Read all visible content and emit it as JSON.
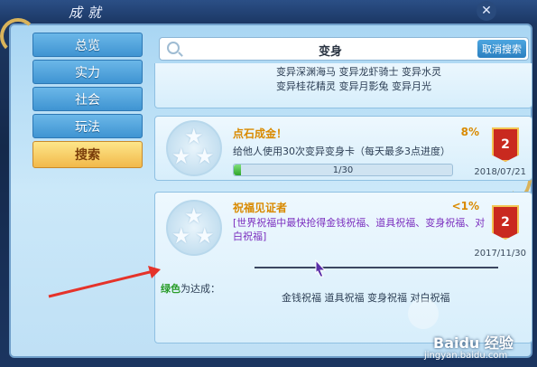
{
  "window": {
    "title": "成就",
    "close_icon": "close-icon"
  },
  "nav": {
    "items": [
      {
        "label": "总览",
        "active": false
      },
      {
        "label": "实力",
        "active": false
      },
      {
        "label": "社会",
        "active": false
      },
      {
        "label": "玩法",
        "active": false
      },
      {
        "label": "搜索",
        "active": true
      }
    ]
  },
  "search": {
    "value": "变身",
    "cancel_label": "取消搜索"
  },
  "achievements": [
    {
      "lines": [
        "变异深渊海马 变异龙虾骑士 变异水灵",
        "变异桂花精灵 变异月影兔 变异月光"
      ]
    },
    {
      "title": "点石成金！",
      "percent": "8%",
      "desc": "给他人使用30次变异变身卡（每天最多3点进度）",
      "progress_text": "1/30",
      "progress_value": 0.0333,
      "flag_number": "2",
      "date": "2018/07/21"
    },
    {
      "title": "祝福见证者",
      "percent": "<1%",
      "desc": "[世界祝福中最快抢得金钱祝福、道具祝福、变身祝福、对白祝福]",
      "flag_number": "2",
      "date": "2017/11/30",
      "condition_prefix": "绿色",
      "condition_suffix": "为达成：",
      "rewards": "金钱祝福 道具祝福 变身祝福 对白祝福"
    }
  ],
  "watermark": {
    "logo": "Baidu 经验",
    "url": "jingyan.baidu.com"
  },
  "colors": {
    "accent_gold": "#d98a00",
    "green": "#2a9d2a",
    "purple": "#7b2fbf",
    "flag_red": "#c9291f"
  }
}
